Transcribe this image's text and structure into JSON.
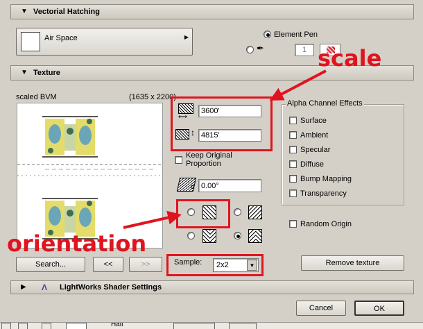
{
  "vectorial_hatching": {
    "title": "Vectorial Hatching",
    "fill_name": "Air Space",
    "element_pen_label": "Element Pen",
    "pen_number": "1"
  },
  "texture": {
    "title": "Texture",
    "image_name": "scaled BVM",
    "image_size": "(1635 x 2200)",
    "width_value": "3600'",
    "height_value": "4815'",
    "keep_proportion_label": "Keep Original Proportion",
    "angle_value": "0.00°",
    "sample_label": "Sample:",
    "sample_value": "2x2",
    "search_label": "Search...",
    "prev_label": "<<",
    "next_label": ">>",
    "remove_label": "Remove texture",
    "random_origin_label": "Random Origin",
    "alpha_group_title": "Alpha Channel Effects",
    "alpha_effects": [
      "Surface",
      "Ambient",
      "Specular",
      "Diffuse",
      "Bump Mapping",
      "Transparency"
    ]
  },
  "lightworks": {
    "title": "LightWorks Shader Settings"
  },
  "dialog": {
    "cancel_label": "Cancel",
    "ok_label": "OK"
  },
  "bottom_bar": {
    "half_label": "Half"
  },
  "annotations": {
    "scale": "scale",
    "orientation": "orientation"
  },
  "colors": {
    "annotation_red": "#e0141e",
    "dialog_bg": "#d4d0c8"
  }
}
